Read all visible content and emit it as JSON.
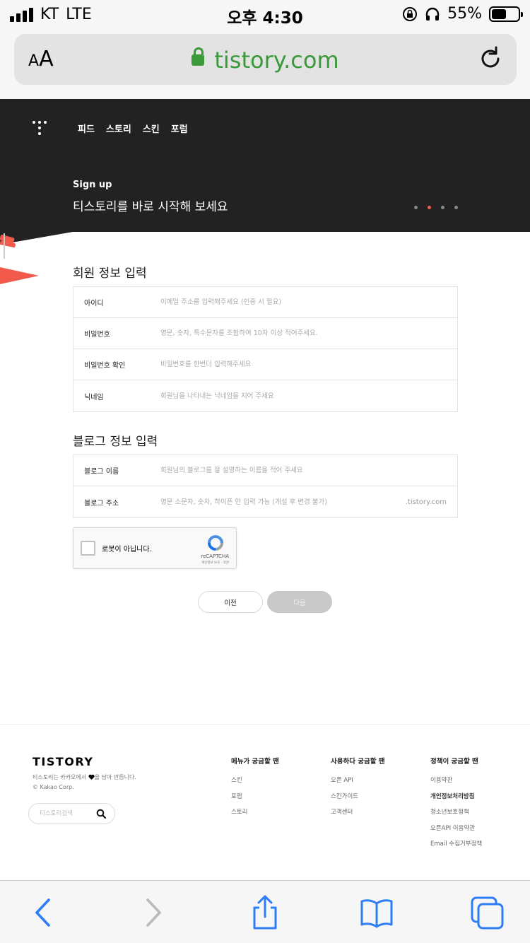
{
  "status_bar": {
    "carrier": "KT",
    "network": "LTE",
    "time": "오후 4:30",
    "battery": "55%",
    "battery_level": 0.55
  },
  "browser": {
    "text_size_small": "A",
    "text_size_large": "A",
    "url": "tistory.com"
  },
  "header": {
    "nav": [
      "피드",
      "스토리",
      "스킨",
      "포럼"
    ],
    "signup_title": "Sign up",
    "signup_subtitle": "티스토리를 바로 시작해 보세요",
    "carousel_active_index": 1
  },
  "member_section": {
    "title": "회원 정보 입력",
    "fields": [
      {
        "label": "아이디",
        "placeholder": "이메일 주소를 입력해주세요 (인증 시 필요)"
      },
      {
        "label": "비밀번호",
        "placeholder": "영문, 숫자, 특수문자를 조합하여 10자 이상 적어주세요."
      },
      {
        "label": "비밀번호 확인",
        "placeholder": "비밀번호를 한번더 입력해주세요"
      },
      {
        "label": "닉네임",
        "placeholder": "회원님을 나타내는 닉네임을 지어 주세요"
      }
    ]
  },
  "blog_section": {
    "title": "블로그 정보 입력",
    "fields": [
      {
        "label": "블로그 이름",
        "placeholder": "회원님의 블로그를 잘 설명하는 이름을 적어 주세요"
      },
      {
        "label": "블로그 주소",
        "placeholder": "영문 소문자, 숫자, 하이픈 만 입력 가능 (개설 후 변경 불가)",
        "suffix": ".tistory.com"
      }
    ]
  },
  "recaptcha": {
    "label": "로봇이 아닙니다.",
    "brand": "reCAPTCHA",
    "privacy": "개인정보 보호 - 약관"
  },
  "buttons": {
    "prev": "이전",
    "next": "다음"
  },
  "footer": {
    "logo": "TISTORY",
    "desc_part1": "티스토리는 카카오에서",
    "desc_part2": "을 담아 만듭니다.",
    "copyright": "© Kakao Corp.",
    "search_placeholder": "티스토리검색",
    "columns": [
      {
        "title": "메뉴가 궁금할 땐",
        "links": [
          "스킨",
          "포럼",
          "스토리"
        ]
      },
      {
        "title": "사용하다 궁금할 땐",
        "links": [
          "오픈 API",
          "스킨가이드",
          "고객센터"
        ]
      },
      {
        "title": "정책이 궁금할 땐",
        "links": [
          "이용약관",
          "개인정보처리방침",
          "청소년보호정책",
          "오픈API 이용약관",
          "Email 수집거부정책"
        ]
      }
    ]
  },
  "colors": {
    "header_bg": "#222222",
    "accent": "#f1594b",
    "url_green": "#3a9a3a",
    "ios_blue": "#2f7df6"
  }
}
